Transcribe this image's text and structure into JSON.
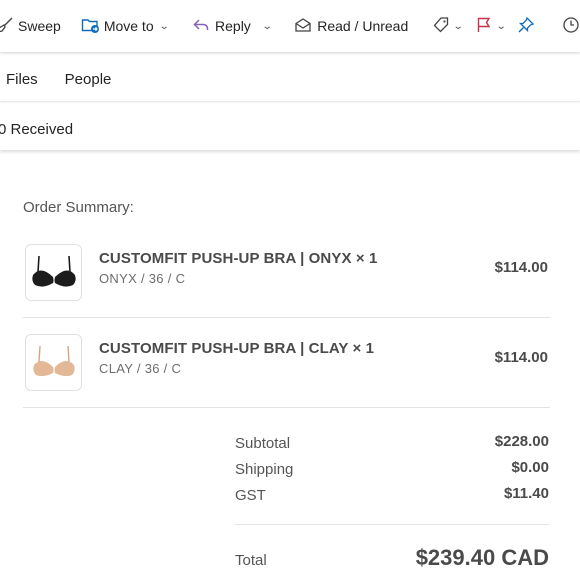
{
  "toolbar": {
    "sweep_label": "Sweep",
    "move_to_label": "Move to",
    "reply_label": "Reply",
    "read_unread_label": "Read / Unread",
    "icons": [
      "broom-icon",
      "folder-move-icon",
      "reply-icon",
      "envelope-open-icon",
      "tag-icon",
      "flag-icon",
      "pin-icon",
      "clock-icon"
    ],
    "accent_colors": {
      "folder": "#0f6cbd",
      "reply": "#8764b8",
      "flag": "#c4314b",
      "pin": "#0f6cbd"
    }
  },
  "tabs": [
    {
      "label": "Files"
    },
    {
      "label": "People"
    }
  ],
  "received_label": "0 Received",
  "order": {
    "title": "Order Summary:",
    "items": [
      {
        "name": "CUSTOMFIT PUSH-UP BRA | ONYX × 1",
        "variant": "ONYX / 36 / C",
        "price": "$114.00",
        "color": "#1c1c1c"
      },
      {
        "name": "CUSTOMFIT PUSH-UP BRA | CLAY × 1",
        "variant": "CLAY / 36 / C",
        "price": "$114.00",
        "color": "#e2b896"
      }
    ],
    "subtotal_label": "Subtotal",
    "subtotal_value": "$228.00",
    "shipping_label": "Shipping",
    "shipping_value": "$0.00",
    "gst_label": "GST",
    "gst_value": "$11.40",
    "total_label": "Total",
    "total_value": "$239.40 CAD"
  }
}
